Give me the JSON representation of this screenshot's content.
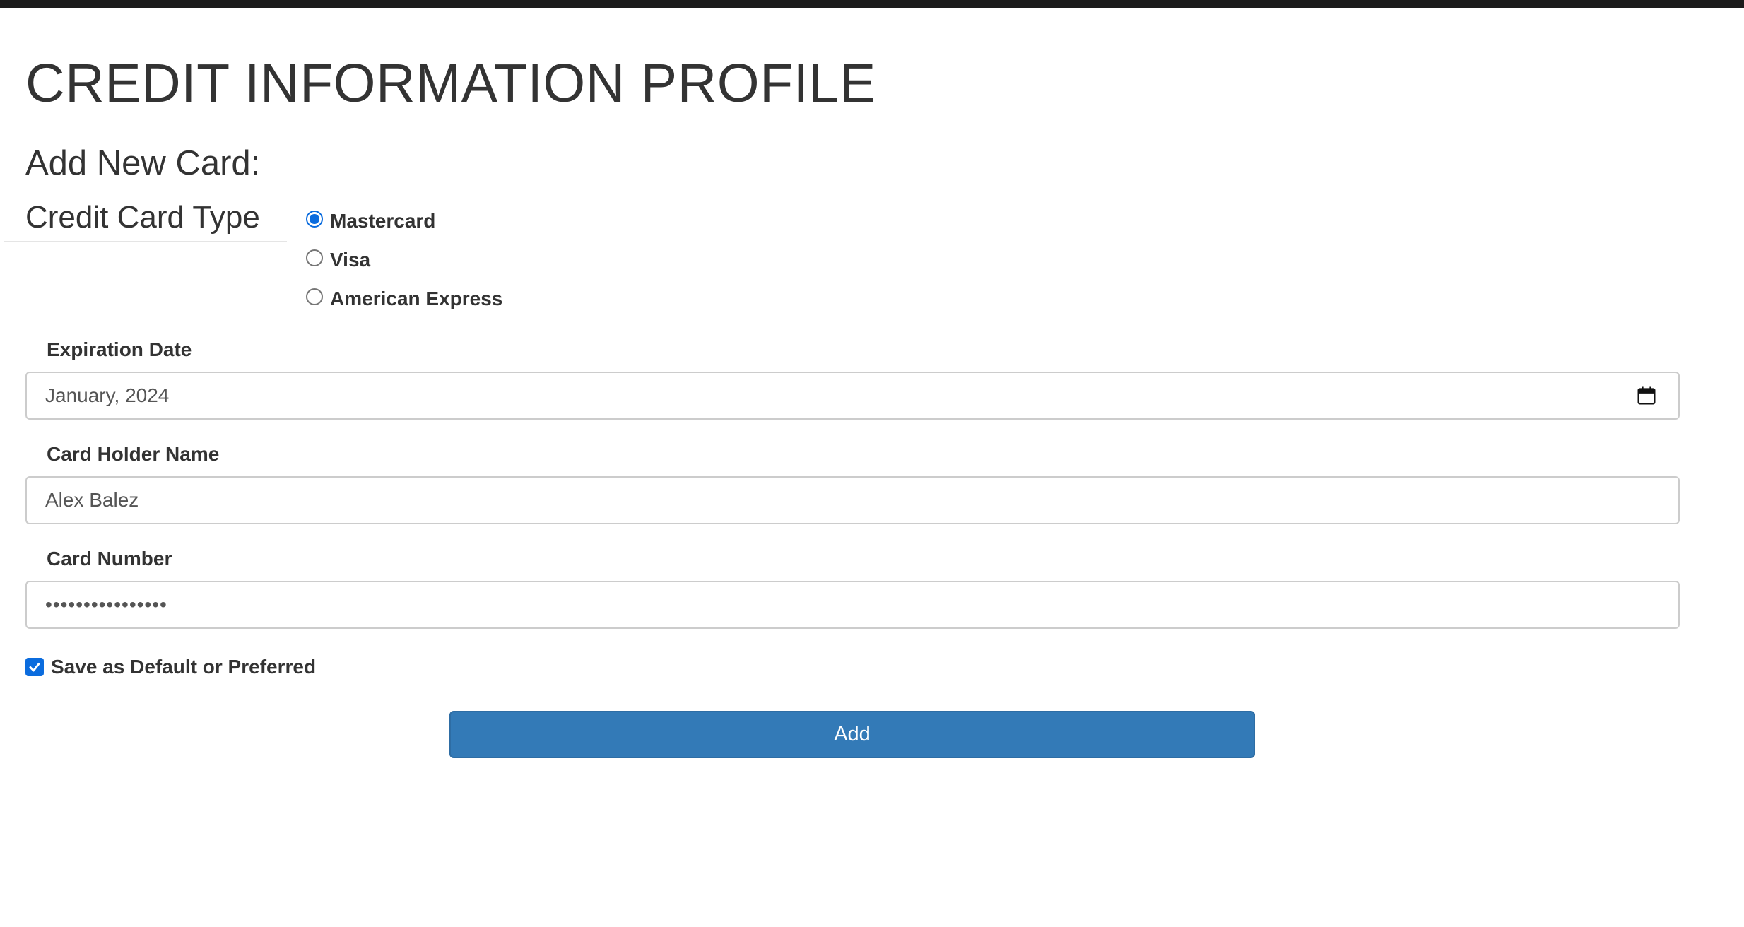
{
  "page": {
    "title": "CREDIT INFORMATION PROFILE",
    "section_title": "Add New Card:"
  },
  "card_type": {
    "legend": "Credit Card Type",
    "options": [
      {
        "label": "Mastercard",
        "checked": true
      },
      {
        "label": "Visa",
        "checked": false
      },
      {
        "label": "American Express",
        "checked": false
      }
    ]
  },
  "fields": {
    "expiration": {
      "label": "Expiration Date",
      "value": "January, 2024",
      "icon": "calendar-icon"
    },
    "holder_name": {
      "label": "Card Holder Name",
      "value": "Alex Balez"
    },
    "card_number": {
      "label": "Card Number",
      "value": "••••••••••••••••"
    }
  },
  "default_checkbox": {
    "label": "Save as Default or Preferred",
    "checked": true
  },
  "add_button": {
    "label": "Add"
  },
  "colors": {
    "accent": "#0b6cde",
    "button": "#337ab7",
    "text": "#333333",
    "border": "#cccccc"
  }
}
